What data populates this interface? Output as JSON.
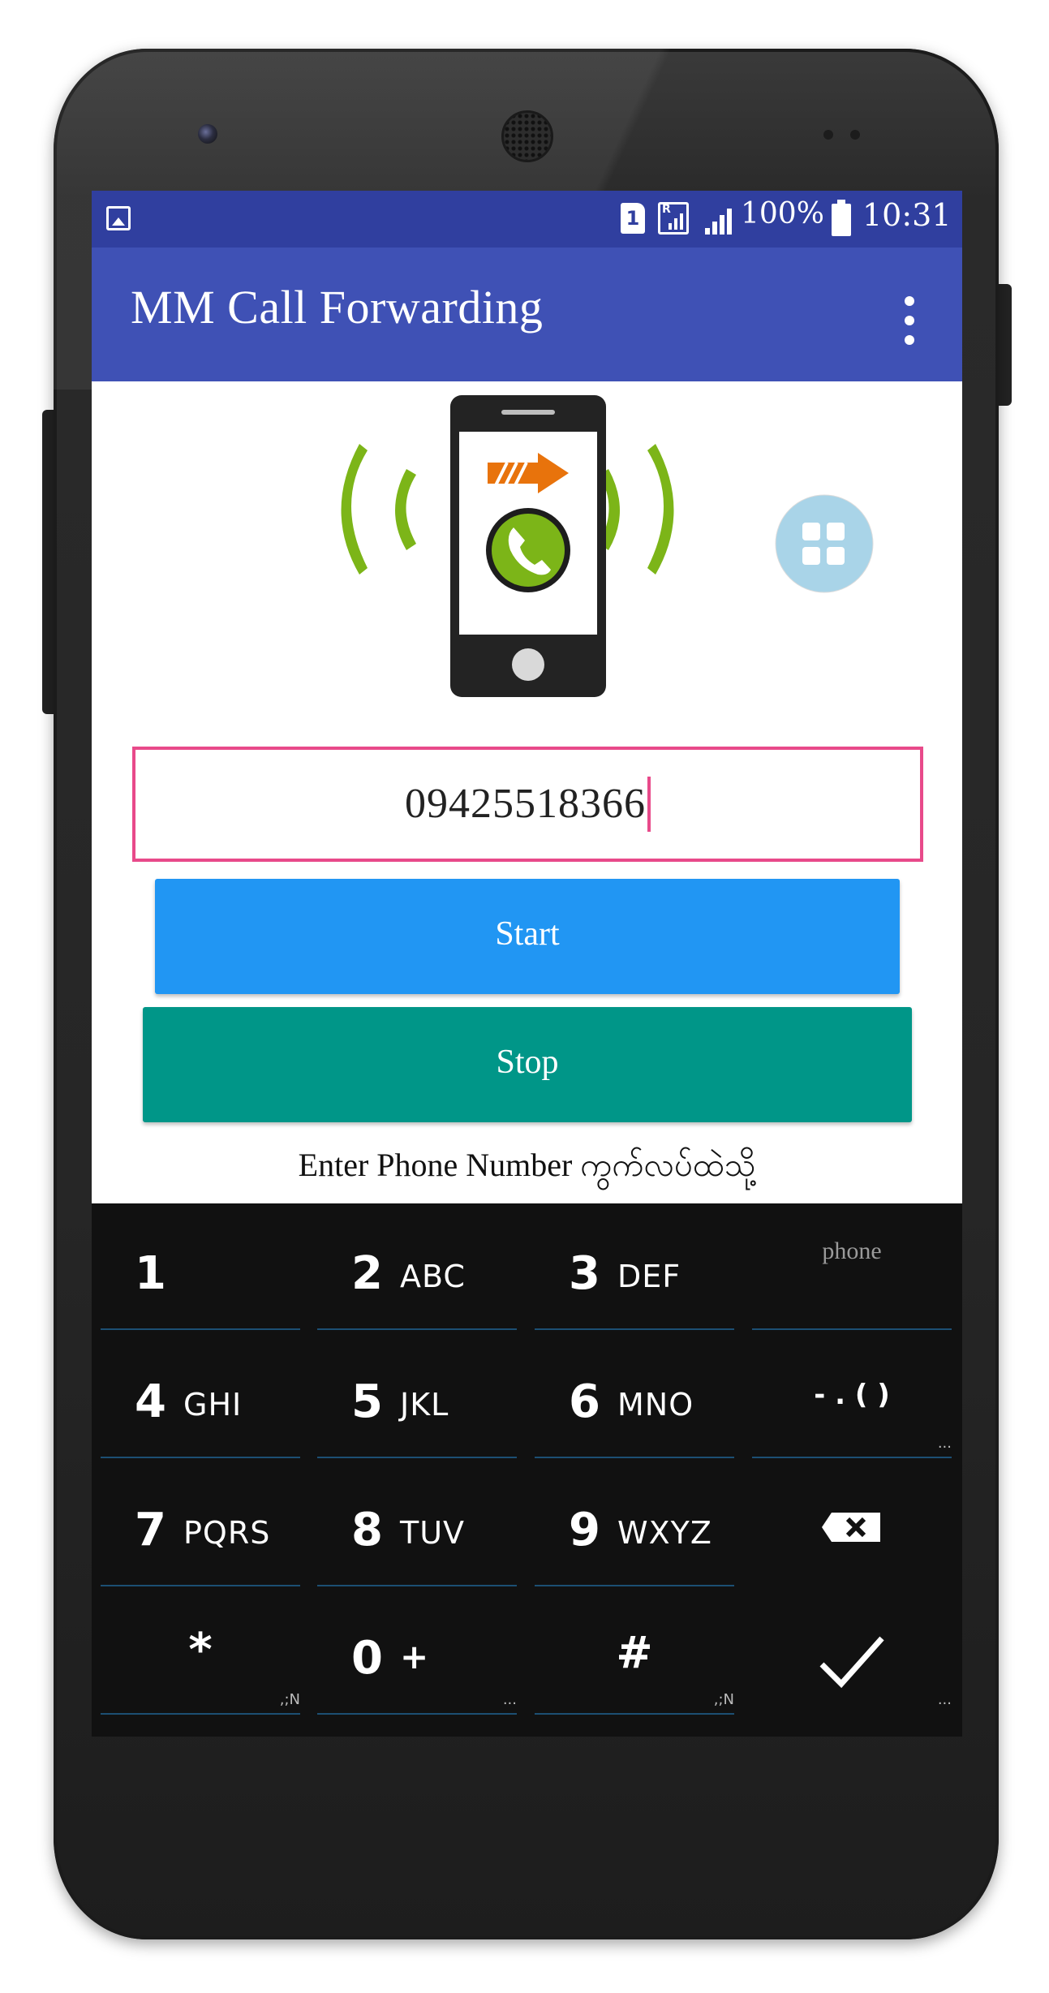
{
  "status_bar": {
    "sim_slot": "1",
    "battery": "100%",
    "time": "10:31"
  },
  "app_bar": {
    "title": "MM Call Forwarding"
  },
  "form": {
    "phone_value": "09425518366",
    "start_label": "Start",
    "stop_label": "Stop",
    "hint_line1": "Enter Phone Number ကွက်လပ်ထဲသို့"
  },
  "keyboard": {
    "mode_label": "phone",
    "rows": [
      [
        {
          "num": "1",
          "letters": ""
        },
        {
          "num": "2",
          "letters": "ABC"
        },
        {
          "num": "3",
          "letters": "DEF"
        }
      ],
      [
        {
          "num": "4",
          "letters": "GHI"
        },
        {
          "num": "5",
          "letters": "JKL"
        },
        {
          "num": "6",
          "letters": "MNO"
        }
      ],
      [
        {
          "num": "7",
          "letters": "PQRS"
        },
        {
          "num": "8",
          "letters": "TUV"
        },
        {
          "num": "9",
          "letters": "WXYZ"
        }
      ]
    ],
    "punct_key": "- . ( )",
    "punct_more": "...",
    "star": "*",
    "star_sub": ",;N",
    "zero": "0",
    "zero_plus": "+",
    "zero_sub": "...",
    "hash": "#",
    "hash_sub": ",;N",
    "done_sub": "..."
  },
  "colors": {
    "status_bar": "#303f9f",
    "app_bar": "#3f51b5",
    "start_button": "#2196f3",
    "stop_button": "#009688",
    "input_border": "#e84a8a",
    "keyboard_bg": "#111111"
  },
  "icons": [
    "image-notification-icon",
    "sim-icon",
    "roaming-signal-icon",
    "signal-icon",
    "battery-icon",
    "overflow-menu-icon",
    "call-forward-phone-icon",
    "apps-grid-icon",
    "backspace-icon",
    "check-icon"
  ]
}
